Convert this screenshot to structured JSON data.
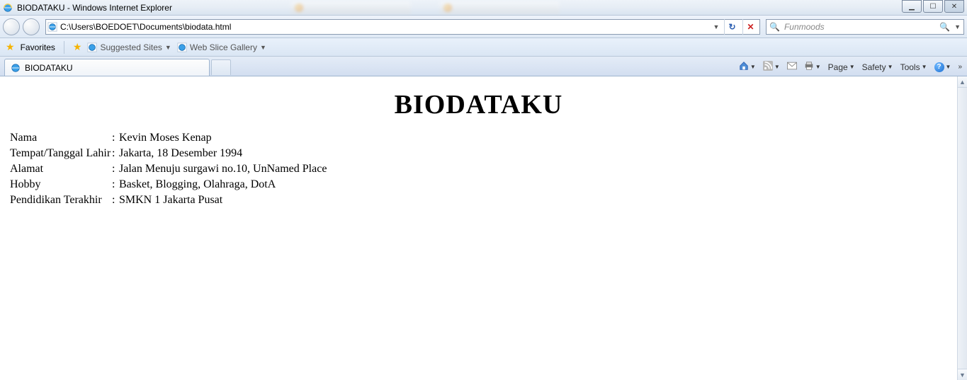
{
  "window": {
    "title": "BIODATAKU - Windows Internet Explorer"
  },
  "address_bar": {
    "url": "C:\\Users\\BOEDOET\\Documents\\biodata.html"
  },
  "search": {
    "placeholder": "Funmoods"
  },
  "favorites_bar": {
    "favorites_label": "Favorites",
    "suggested_sites": "Suggested Sites",
    "web_slice_gallery": "Web Slice Gallery"
  },
  "tab": {
    "title": "BIODATAKU"
  },
  "command_bar": {
    "page": "Page",
    "safety": "Safety",
    "tools": "Tools"
  },
  "page_content": {
    "heading": "BIODATAKU",
    "rows": {
      "nama_label": "Nama",
      "nama_value": "Kevin Moses Kenap",
      "ttl_label": "Tempat/Tanggal Lahir",
      "ttl_value": "Jakarta, 18 Desember 1994",
      "alamat_label": "Alamat",
      "alamat_value": "Jalan Menuju surgawi no.10, UnNamed Place",
      "hobby_label": "Hobby",
      "hobby_value": "Basket, Blogging, Olahraga, DotA",
      "pendidikan_label": "Pendidikan Terakhir",
      "pendidikan_value": "SMKN 1 Jakarta Pusat"
    }
  }
}
